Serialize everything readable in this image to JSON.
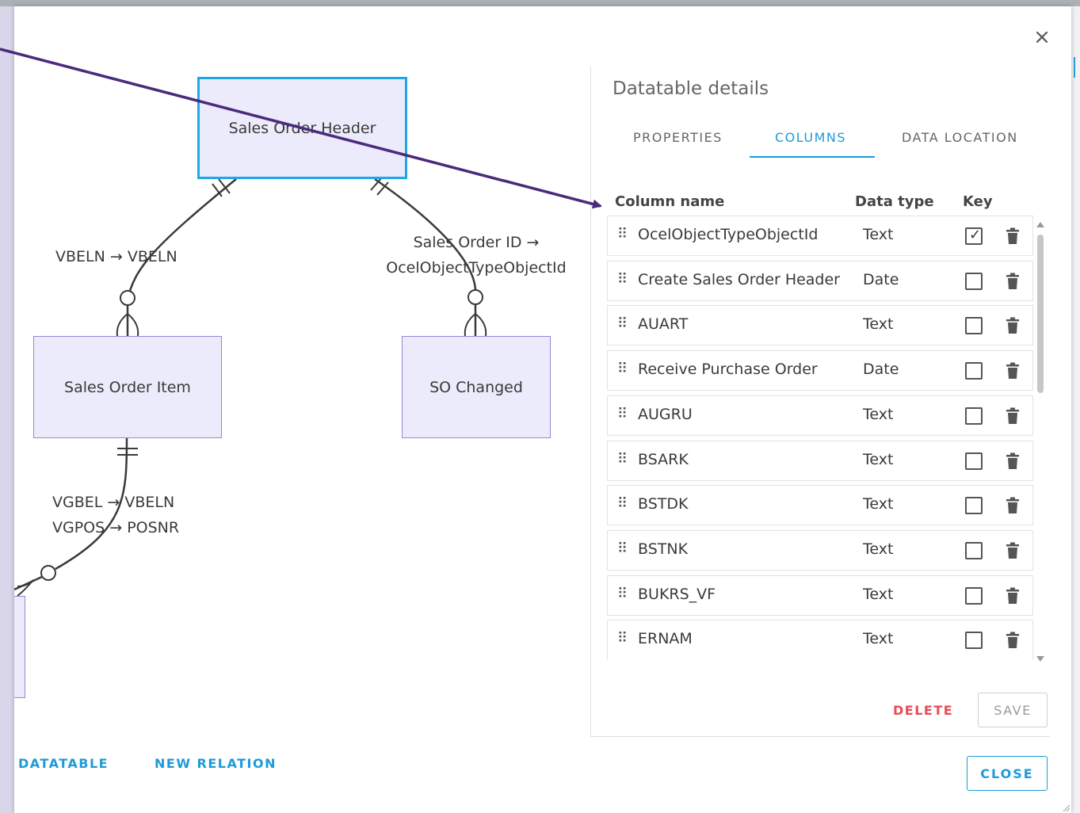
{
  "dialog": {
    "close_icon": "×"
  },
  "diagram": {
    "nodes": {
      "sales_order_header": "Sales Order Header",
      "sales_order_item": "Sales Order Item",
      "so_changed": "SO Changed"
    },
    "relations": {
      "header_item": "VBELN → VBELN",
      "header_changed_line1": "Sales Order ID →",
      "header_changed_line2": "OcelObjectTypeObjectId",
      "item_next_line1": "VGBEL → VBELN",
      "item_next_line2": "VGPOS → POSNR"
    }
  },
  "bottom_actions": {
    "new_datatable": "DATATABLE",
    "new_relation": "NEW RELATION",
    "close": "CLOSE"
  },
  "details_panel": {
    "title": "Datatable details",
    "tabs": [
      {
        "label": "PROPERTIES",
        "active": false
      },
      {
        "label": "COLUMNS",
        "active": true
      },
      {
        "label": "DATA LOCATION",
        "active": false
      }
    ],
    "headers": {
      "column_name": "Column name",
      "data_type": "Data type",
      "key": "Key"
    },
    "columns": [
      {
        "name": "OcelObjectTypeObjectId",
        "type": "Text",
        "key": true
      },
      {
        "name": "Create Sales Order Header",
        "type": "Date",
        "key": false
      },
      {
        "name": "AUART",
        "type": "Text",
        "key": false
      },
      {
        "name": "Receive Purchase Order",
        "type": "Date",
        "key": false
      },
      {
        "name": "AUGRU",
        "type": "Text",
        "key": false
      },
      {
        "name": "BSARK",
        "type": "Text",
        "key": false
      },
      {
        "name": "BSTDK",
        "type": "Text",
        "key": false
      },
      {
        "name": "BSTNK",
        "type": "Text",
        "key": false
      },
      {
        "name": "BUKRS_VF",
        "type": "Text",
        "key": false
      },
      {
        "name": "ERNAM",
        "type": "Text",
        "key": false
      }
    ],
    "delete_label": "DELETE",
    "save_label": "SAVE"
  },
  "colors": {
    "accent": "#1e9bd7",
    "danger": "#e94b55",
    "node_fill": "#ebebfb",
    "node_border": "#9c84d8",
    "annotation_arrow": "#4b2a7b"
  },
  "icons": {
    "drag": "drag-handle-icon",
    "trash": "trash-icon",
    "checkbox": "checkbox-icon"
  }
}
